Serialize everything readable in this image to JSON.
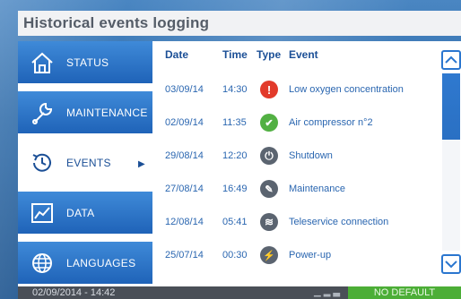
{
  "page": {
    "title": "Historical events logging"
  },
  "sidebar": {
    "items": [
      {
        "label": "STATUS",
        "icon": "home-icon",
        "active": false
      },
      {
        "label": "MAINTENANCE",
        "icon": "wrench-icon",
        "active": false
      },
      {
        "label": "EVENTS",
        "icon": "clock-history-icon",
        "active": true
      },
      {
        "label": "DATA",
        "icon": "chart-icon",
        "active": false
      },
      {
        "label": "LANGUAGES",
        "icon": "globe-icon",
        "active": false
      }
    ]
  },
  "table": {
    "headers": {
      "date": "Date",
      "time": "Time",
      "type": "Type",
      "event": "Event"
    },
    "rows": [
      {
        "date": "03/09/14",
        "time": "14:30",
        "type_icon": "alert-icon",
        "type_color": "#e23a2a",
        "type_glyph": "!",
        "event": "Low oxygen concentration"
      },
      {
        "date": "02/09/14",
        "time": "11:35",
        "type_icon": "check-icon",
        "type_color": "#52b043",
        "type_glyph": "✔",
        "event": "Air compressor n°2"
      },
      {
        "date": "29/08/14",
        "time": "12:20",
        "type_icon": "power-icon",
        "type_color": "#5b6470",
        "type_glyph": "⏻",
        "event": "Shutdown"
      },
      {
        "date": "27/08/14",
        "time": "16:49",
        "type_icon": "wrench-icon",
        "type_color": "#5b6470",
        "type_glyph": "✎",
        "event": "Maintenance"
      },
      {
        "date": "12/08/14",
        "time": "05:41",
        "type_icon": "wifi-icon",
        "type_color": "#5b6470",
        "type_glyph": "≋",
        "event": "Teleservice connection"
      },
      {
        "date": "25/07/14",
        "time": "00:30",
        "type_icon": "bolt-icon",
        "type_color": "#5b6470",
        "type_glyph": "⚡",
        "event": "Power-up"
      }
    ]
  },
  "scrollbar": {
    "up_icon": "chevron-up-icon",
    "down_icon": "chevron-down-icon"
  },
  "statusbar": {
    "datetime": "02/09/2014 - 14:42",
    "status": "NO DEFAULT"
  },
  "colors": {
    "accent": "#2a76cf",
    "ok": "#4cae37",
    "alarm": "#e23a2a"
  }
}
